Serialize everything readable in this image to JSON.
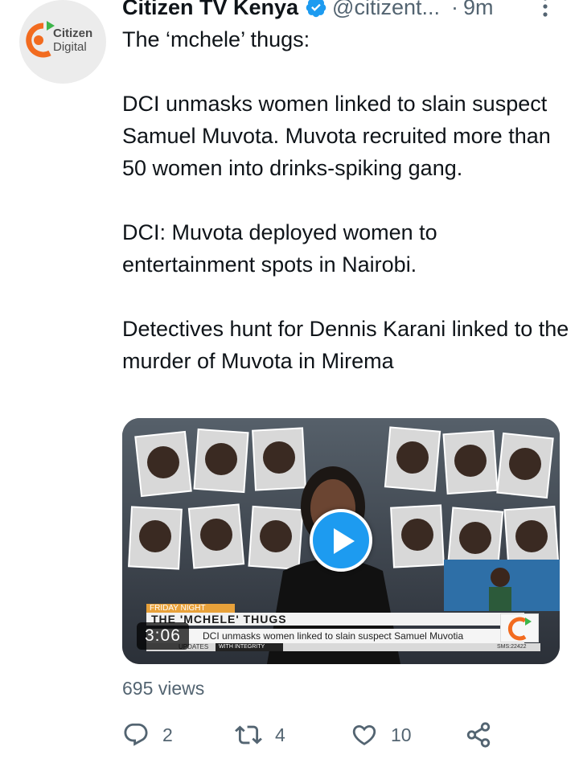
{
  "author": {
    "display_name": "Citizen TV Kenya",
    "handle": "@citizent...",
    "timestamp": "9m",
    "separator": "·",
    "verified": true,
    "avatar": {
      "line1": "Citizen",
      "line2": "Digital",
      "brand_colors": {
        "orange": "#f26b1f",
        "green": "#3cb54a"
      }
    }
  },
  "tweet": {
    "paragraphs": [
      "The ‘mchele’ thugs:",
      "",
      "DCI unmasks women linked to slain suspect Samuel Muvota. Muvota recruited more than 50 women into drinks-spiking gang.",
      "",
      "DCI: Muvota deployed women to entertainment spots in Nairobi.",
      "",
      "Detectives hunt for Dennis Karani linked to the murder of Muvota in Mirema"
    ]
  },
  "media": {
    "type": "video",
    "duration": "3:06",
    "play_icon": "play-icon",
    "ticker": {
      "kicker": "FRIDAY NIGHT",
      "headline": "THE 'MCHELE' THUGS",
      "line": "DCI unmasks women linked to slain suspect Samuel Muvotia",
      "tag": "UPDATES",
      "sub": "WITH INTEGRITY",
      "sms": "SMS:22422"
    }
  },
  "stats": {
    "views": "695 views"
  },
  "actions": {
    "reply": {
      "icon": "reply-icon",
      "count": "2"
    },
    "retweet": {
      "icon": "retweet-icon",
      "count": "4"
    },
    "like": {
      "icon": "heart-icon",
      "count": "10"
    },
    "share": {
      "icon": "share-icon"
    }
  },
  "colors": {
    "accent": "#1d9bf0",
    "text": "#0f1419",
    "secondary": "#536471"
  }
}
